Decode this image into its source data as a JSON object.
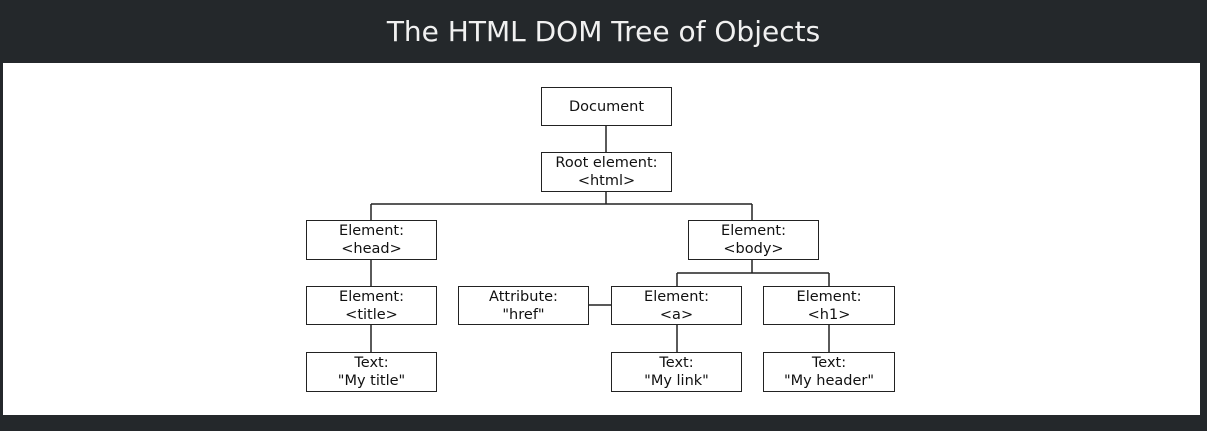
{
  "header": {
    "title": "The HTML DOM Tree of Objects"
  },
  "nodes": {
    "document": {
      "line1": "Document"
    },
    "root": {
      "line1": "Root element:",
      "line2": "<html>"
    },
    "head": {
      "line1": "Element:",
      "line2": "<head>"
    },
    "body": {
      "line1": "Element:",
      "line2": "<body>"
    },
    "title": {
      "line1": "Element:",
      "line2": "<title>"
    },
    "attr": {
      "line1": "Attribute:",
      "line2": "\"href\""
    },
    "a": {
      "line1": "Element:",
      "line2": "<a>"
    },
    "h1": {
      "line1": "Element:",
      "line2": "<h1>"
    },
    "text_title": {
      "line1": "Text:",
      "line2": "\"My title\""
    },
    "text_link": {
      "line1": "Text:",
      "line2": "\"My link\""
    },
    "text_header": {
      "line1": "Text:",
      "line2": "\"My header\""
    }
  }
}
